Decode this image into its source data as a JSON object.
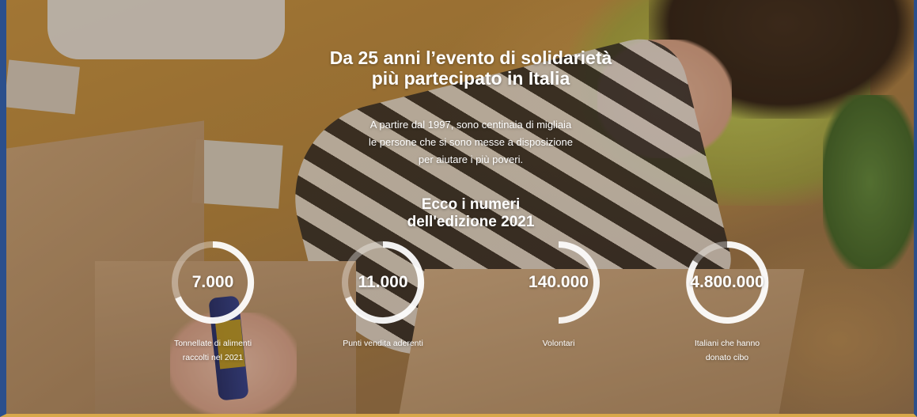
{
  "hero": {
    "title_line1": "Da 25 anni l’evento di solidarietà",
    "title_line2": "più partecipato in Italia",
    "subtitle_line1": "A partire dal 1997, sono centinaia di migliaia",
    "subtitle_line2": "le persone che si sono messe a disposizione",
    "subtitle_line3": "per aiutare i più poveri.",
    "numbers_title_line1": "Ecco i numeri",
    "numbers_title_line2": "dell'edizione 2021"
  },
  "stats": [
    {
      "value": "7.000",
      "label_line1": "Tonnellate di alimenti",
      "label_line2": "raccolti nel 2021"
    },
    {
      "value": "11.000",
      "label_line1": "Punti vendita aderenti",
      "label_line2": ""
    },
    {
      "value": "140.000",
      "label_line1": "Volontari",
      "label_line2": ""
    },
    {
      "value": "4.800.000",
      "label_line1": "Italiani che hanno",
      "label_line2": "donato cibo"
    }
  ],
  "colors": {
    "ring_faint": "#ffffff55",
    "ring_strong": "#ffffffe6",
    "frame_left": "#2b4f8c",
    "frame_bottom": "#d8a84a"
  }
}
